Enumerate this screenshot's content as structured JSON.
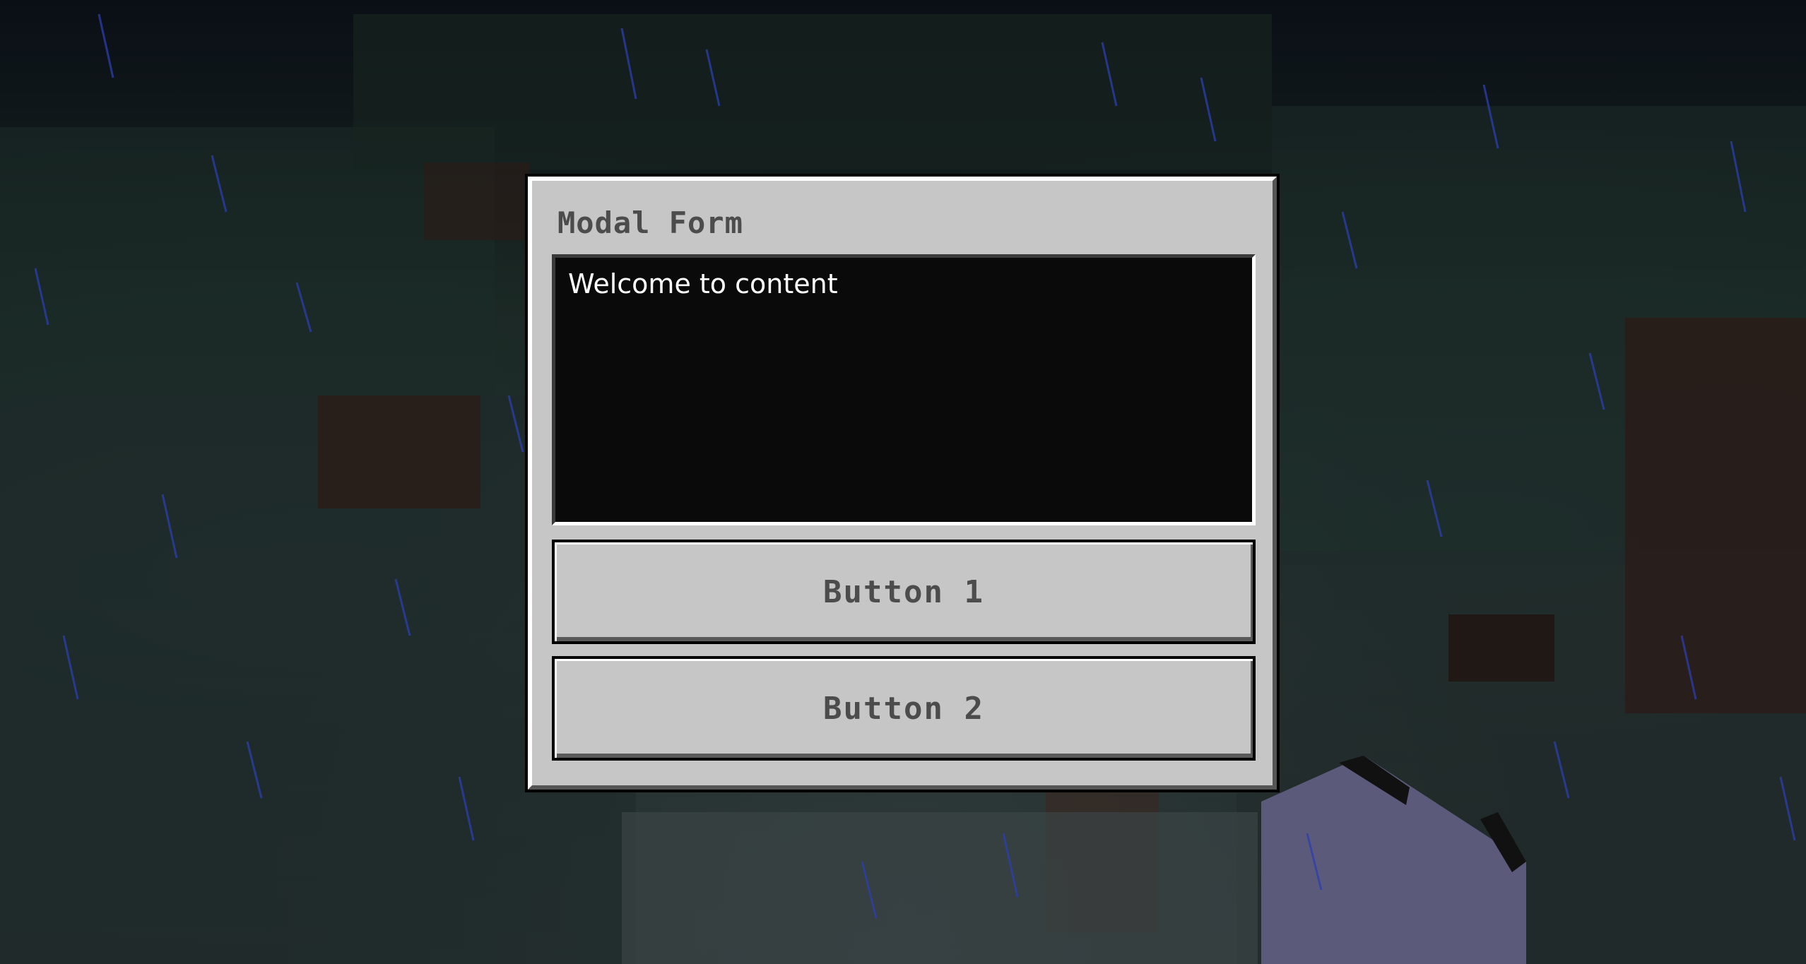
{
  "modal": {
    "title": "Modal Form",
    "content": "Welcome to content",
    "buttons": [
      {
        "label": "Button 1"
      },
      {
        "label": "Button 2"
      }
    ]
  },
  "colors": {
    "panel": "#c6c6c6",
    "content_bg": "#0a0a0b",
    "text_dark": "#4c4c4c",
    "text_light": "#ffffff"
  }
}
